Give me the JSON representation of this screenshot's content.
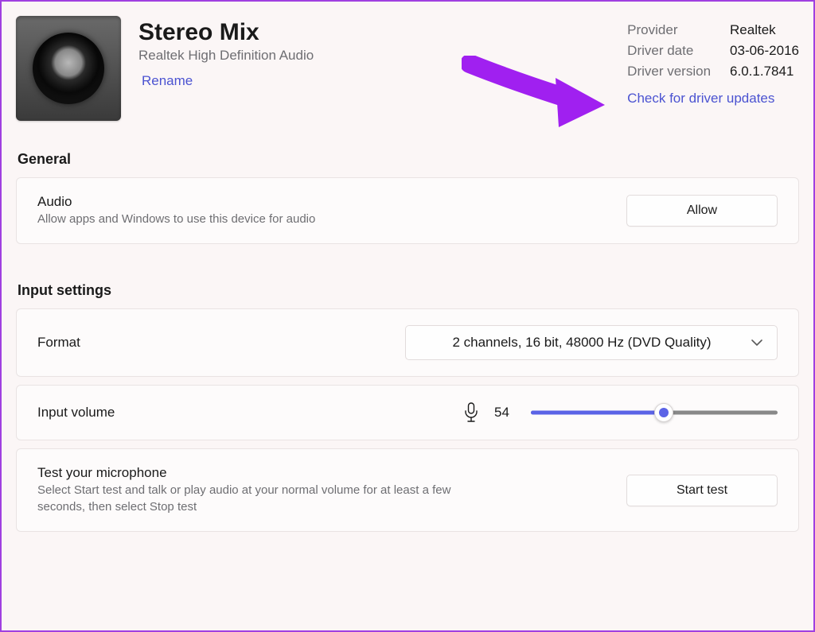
{
  "device": {
    "name": "Stereo Mix",
    "subtitle": "Realtek High Definition Audio",
    "rename_label": "Rename"
  },
  "driver": {
    "provider_label": "Provider",
    "provider_value": "Realtek",
    "date_label": "Driver date",
    "date_value": "03-06-2016",
    "version_label": "Driver version",
    "version_value": "6.0.1.7841",
    "check_updates_label": "Check for driver updates"
  },
  "sections": {
    "general_heading": "General",
    "input_heading": "Input settings"
  },
  "audio": {
    "title": "Audio",
    "desc": "Allow apps and Windows to use this device for audio",
    "button": "Allow"
  },
  "format": {
    "label": "Format",
    "selected": "2 channels, 16 bit, 48000 Hz (DVD Quality)"
  },
  "volume": {
    "label": "Input volume",
    "value": "54",
    "percent": 54
  },
  "test": {
    "title": "Test your microphone",
    "desc": "Select Start test and talk or play audio at your normal volume for at least a few seconds, then select Stop test",
    "button": "Start test"
  }
}
